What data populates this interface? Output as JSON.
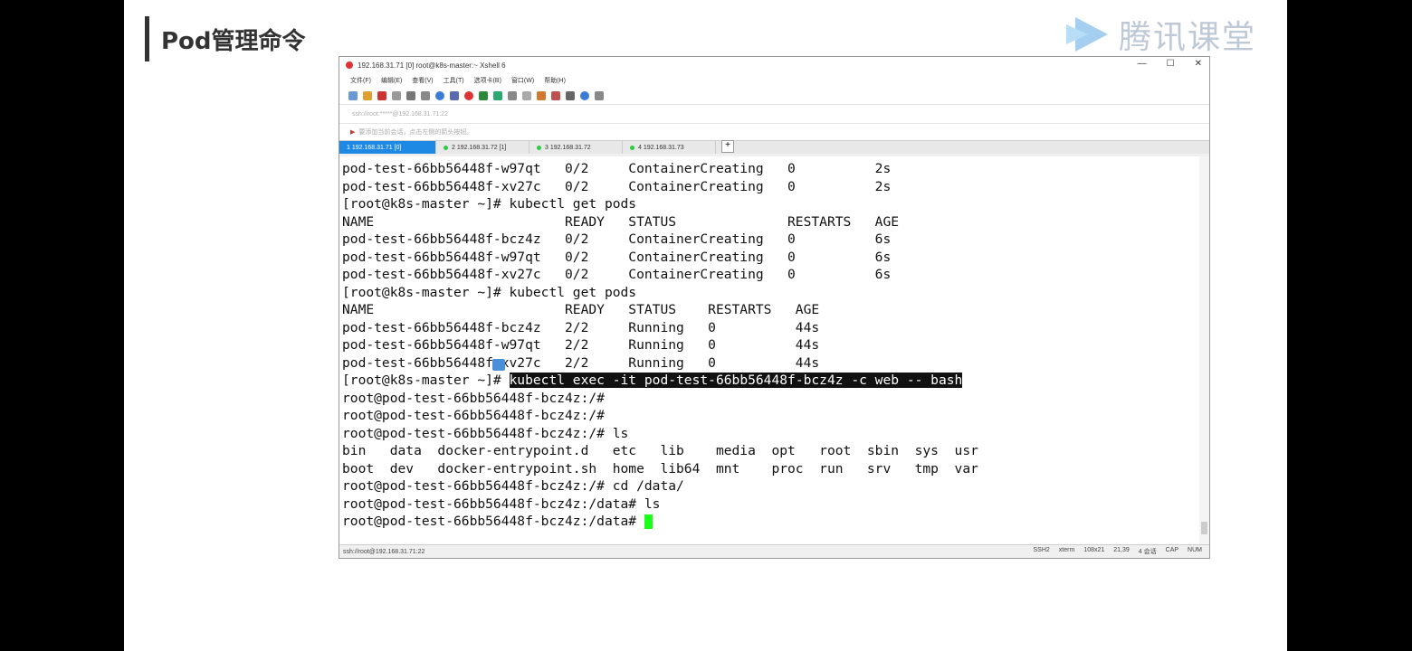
{
  "slide": {
    "title": "Pod管理命令",
    "logo_text": "腾讯课堂"
  },
  "window": {
    "title": "192.168.31.71 [0]   root@k8s-master:~   Xshell 6",
    "controls": [
      "—",
      "☐",
      "✕"
    ],
    "menu": [
      "文件(F)",
      "编辑(E)",
      "查看(V)",
      "工具(T)",
      "选项卡(B)",
      "窗口(W)",
      "帮助(H)"
    ],
    "address": "ssh://root:*****@192.168.31.71:22",
    "hint": "要添加当前会话，点击左侧的箭头按钮。",
    "tabs": [
      {
        "label": "1 192.168.31.71 [0]",
        "active": true
      },
      {
        "label": "2 192.168.31.72 [1]",
        "active": false
      },
      {
        "label": "3 192.168.31.72",
        "active": false
      },
      {
        "label": "4 192.168.31.73",
        "active": false
      }
    ],
    "tab_add": "+"
  },
  "terminal": {
    "lines": [
      "pod-test-66bb56448f-w97qt   0/2     ContainerCreating   0          2s",
      "pod-test-66bb56448f-xv27c   0/2     ContainerCreating   0          2s",
      "[root@k8s-master ~]# kubectl get pods",
      "NAME                        READY   STATUS              RESTARTS   AGE",
      "pod-test-66bb56448f-bcz4z   0/2     ContainerCreating   0          6s",
      "pod-test-66bb56448f-w97qt   0/2     ContainerCreating   0          6s",
      "pod-test-66bb56448f-xv27c   0/2     ContainerCreating   0          6s",
      "[root@k8s-master ~]# kubectl get pods",
      "NAME                        READY   STATUS    RESTARTS   AGE",
      "pod-test-66bb56448f-bcz4z   2/2     Running   0          44s",
      "pod-test-66bb56448f-w97qt   2/2     Running   0          44s",
      "pod-test-66bb56448f-xv27c   2/2     Running   0          44s"
    ],
    "prompt_exec": "[root@k8s-master ~]# ",
    "selected_command": "kubectl exec -it pod-test-66bb56448f-bcz4z -c web -- bash",
    "lines_after": [
      "root@pod-test-66bb56448f-bcz4z:/#",
      "root@pod-test-66bb56448f-bcz4z:/#",
      "root@pod-test-66bb56448f-bcz4z:/# ls",
      "bin   data  docker-entrypoint.d   etc   lib    media  opt   root  sbin  sys  usr",
      "boot  dev   docker-entrypoint.sh  home  lib64  mnt    proc  run   srv   tmp  var",
      "root@pod-test-66bb56448f-bcz4z:/# cd /data/",
      "root@pod-test-66bb56448f-bcz4z:/data# ls"
    ],
    "last_prompt": "root@pod-test-66bb56448f-bcz4z:/data# "
  },
  "status": {
    "left": "ssh://root@192.168.31.71:22",
    "items": [
      "SSH2",
      "xterm",
      "108x21",
      "21,39",
      "4 会话",
      "CAP",
      "NUM"
    ]
  },
  "colors": {
    "tab_active": "#1e88e5",
    "cursor": "#1aff1a",
    "selection": "#111111"
  }
}
